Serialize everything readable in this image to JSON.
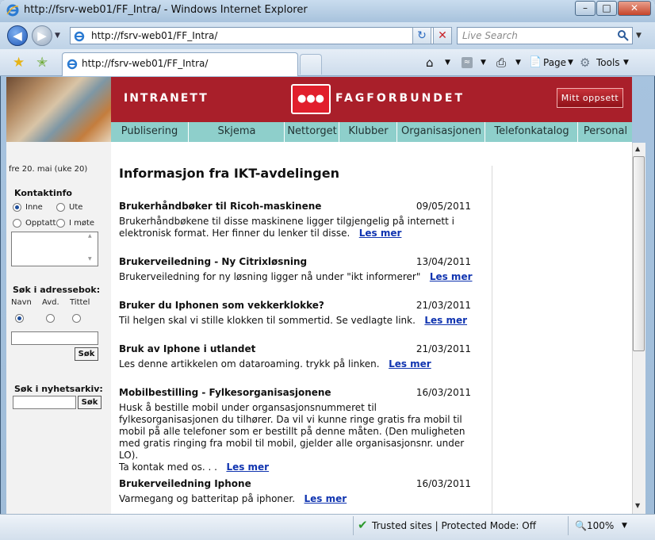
{
  "browser": {
    "title": "http://fsrv-web01/FF_Intra/ - Windows Internet Explorer",
    "address": "http://fsrv-web01/FF_Intra/",
    "search_placeholder": "Live Search",
    "tab_title": "http://fsrv-web01/FF_Intra/",
    "toolbar": {
      "page": "Page",
      "tools": "Tools"
    },
    "status": {
      "zone": "Trusted sites | Protected Mode: Off",
      "zoom": "100%"
    }
  },
  "site": {
    "header_left": "INTRANETT",
    "brand": "FAGFORBUNDET",
    "mitt_oppsett": "Mitt oppsett",
    "menu": [
      "Publisering",
      "Skjema",
      "Nettorget",
      "Klubber",
      "Organisasjonen",
      "Telefonkatalog",
      "Personal"
    ]
  },
  "sidebar": {
    "date": "fre 20. mai (uke 20)",
    "kontaktinfo": {
      "label": "Kontaktinfo",
      "options": [
        "Inne",
        "Ute",
        "Opptatt",
        "I møte"
      ],
      "selected": "Inne"
    },
    "adressebok": {
      "label": "Søk i adressebok:",
      "columns": [
        "Navn",
        "Avd.",
        "Tittel"
      ],
      "selected": "Navn",
      "button": "Søk"
    },
    "nyhetsarkiv": {
      "label": "Søk i nyhetsarkiv:",
      "button": "Søk"
    }
  },
  "main": {
    "heading": "Informasjon fra IKT-avdelingen",
    "read_more": "Les mer",
    "news": [
      {
        "title": "Brukerhåndbøker til Ricoh-maskinene",
        "date": "09/05/2011",
        "text": "Brukerhåndbøkene til disse maskinene ligger tilgjengelig på internett i elektronisk format. Her finner du lenker til disse."
      },
      {
        "title": "Brukerveiledning - Ny Citrixløsning",
        "date": "13/04/2011",
        "text": "Brukerveiledning for ny løsning ligger nå under \"ikt informerer\""
      },
      {
        "title": "Bruker du Iphonen som vekkerklokke?",
        "date": "21/03/2011",
        "text": "Til helgen skal vi stille klokken til sommertid. Se vedlagte link."
      },
      {
        "title": "Bruk av Iphone i utlandet",
        "date": "21/03/2011",
        "text": "Les denne artikkelen om dataroaming. trykk på linken."
      },
      {
        "title": "Mobilbestilling - Fylkesorganisasjonene",
        "date": "16/03/2011",
        "text": "Husk å bestille mobil under organsasjonsnummeret til fylkesorganisasjonen du tilhører. Da vil vi kunne ringe gratis fra mobil til mobil på alle telefoner som er bestillt på denne måten. (Den muligheten med gratis ringing fra mobil til mobil, gjelder alle organisasjonsnr. under LO).",
        "text2": "Ta kontak med os. . ."
      },
      {
        "title": "Brukerveiledning Iphone",
        "date": "16/03/2011",
        "text": "Varmegang og batteritap på iphoner."
      }
    ]
  },
  "colors": {
    "header_red": "#a91f2a",
    "menu_teal": "#8ecfcb",
    "link_blue": "#1034b0"
  }
}
